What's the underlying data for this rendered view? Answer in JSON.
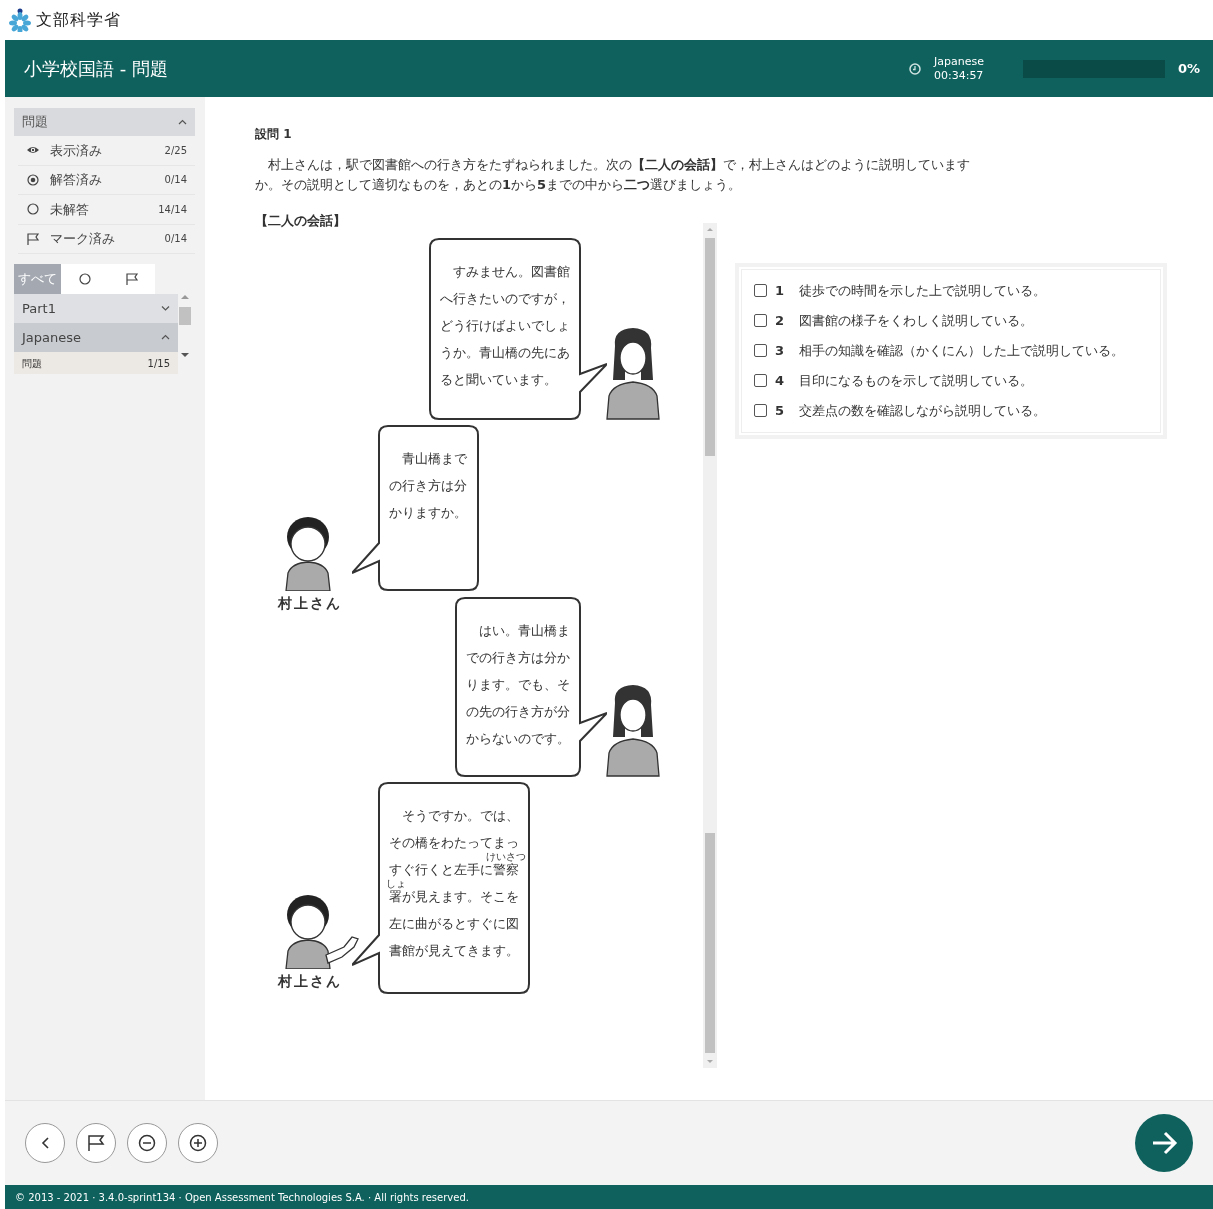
{
  "logo": {
    "text": "文部科学省"
  },
  "header": {
    "title": "小学校国語 - 問題",
    "timer": {
      "label": "Japanese",
      "time": "00:34:57"
    },
    "progress": {
      "level": 0,
      "text": "0%"
    }
  },
  "sidebar": {
    "section": {
      "title": "問題",
      "expanded": true
    },
    "items": [
      {
        "kind": "viewed",
        "label": "表示済み",
        "count": "2/25"
      },
      {
        "kind": "answered",
        "label": "解答済み",
        "count": "0/14"
      },
      {
        "kind": "unanswered",
        "label": "未解答",
        "count": "14/14"
      },
      {
        "kind": "flagged",
        "label": "マーク済み",
        "count": "0/14"
      }
    ],
    "filters": [
      {
        "kind": "all",
        "label": "すべて",
        "selected": true
      },
      {
        "kind": "unanswered",
        "selected": false
      },
      {
        "kind": "flagged",
        "selected": false
      }
    ],
    "parts": [
      {
        "label": "Part1",
        "expanded": false
      },
      {
        "label": "Japanese",
        "expanded": true,
        "items": [
          {
            "label": "問題",
            "count": "1/15"
          }
        ]
      }
    ]
  },
  "question": {
    "heading": "設問 1",
    "prompt": "村上さんは，駅で図書館への行き方をたずねられました。次の**【二人の会話】**で，村上さんはどのように説明していますか。その説明として適切なものを，あとの**1**から**5**までの中から**二つ**選びましょう。",
    "dialogue_title": "【二人の会話】",
    "dialogue": [
      {
        "kind": "passerby",
        "lines": [
          "すみません。図書館",
          "へ行きたいのですが，",
          "どう行けばよいでしょ",
          "うか。青山橋の先にあ",
          "ると聞いています。"
        ]
      },
      {
        "kind": "murakami",
        "name": "村上さん",
        "lines": [
          "青山橋まで",
          "の行き方は分",
          "かりますか。"
        ]
      },
      {
        "kind": "passerby",
        "lines": [
          "はい。青山橋ま",
          "での行き方は分か",
          "ります。でも、そ",
          "の先の行き方が分",
          "からないのです。"
        ]
      },
      {
        "kind": "murakami",
        "name": "村上さん",
        "lines": [
          "そうですか。では、",
          "その橋をわたってまっ",
          [
            "すぐ行くと左手に",
            {
              "base": "警察",
              "ruby": "けいさつ"
            }
          ],
          [
            {
              "base": "署",
              "ruby": "しょ"
            },
            "が見えます。そこを"
          ],
          "左に曲がるとすぐに図",
          "書館が見えてきます。"
        ]
      }
    ],
    "options": [
      {
        "number": "1",
        "text": "徒歩での時間を示した上で説明している。",
        "checked": false
      },
      {
        "number": "2",
        "text": "図書館の様子をくわしく説明している。",
        "checked": false
      },
      {
        "number": "3",
        "text": "相手の知識を確認（かくにん）した上で説明している。",
        "checked": false
      },
      {
        "number": "4",
        "text": "目印になるものを示して説明している。",
        "checked": false
      },
      {
        "number": "5",
        "text": "交差点の数を確認しながら説明している。",
        "checked": false
      }
    ]
  },
  "toolbar": {
    "buttons": [
      {
        "kind": "previous"
      },
      {
        "kind": "flag"
      },
      {
        "kind": "zoom-out"
      },
      {
        "kind": "zoom-in"
      }
    ],
    "next": {
      "kind": "next"
    }
  },
  "footer": {
    "text": "© 2013 - 2021 · 3.4.0-sprint134 · Open Assessment Technologies S.A. · All rights reserved."
  }
}
